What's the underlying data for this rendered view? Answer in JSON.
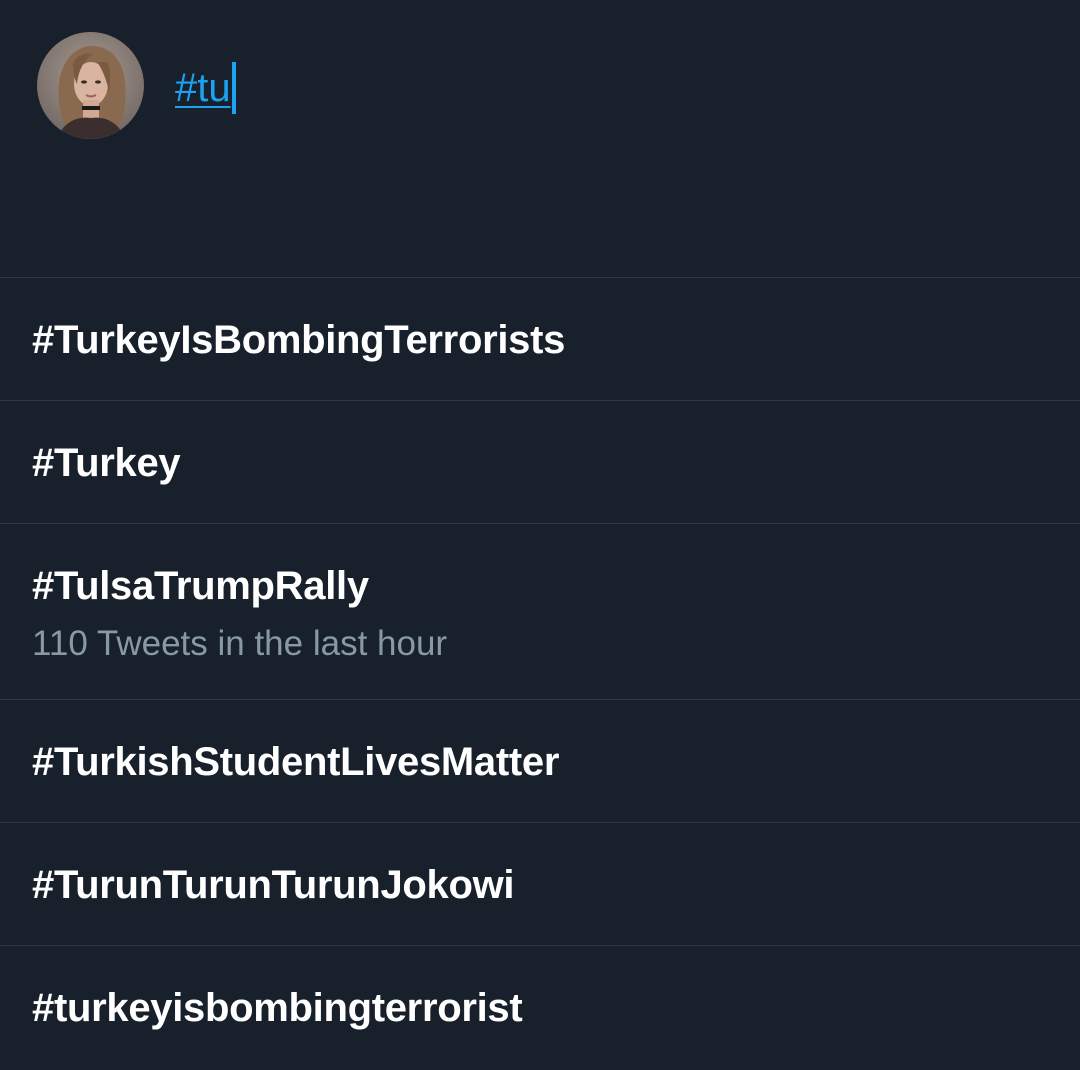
{
  "compose": {
    "query": "#tu",
    "avatar_icon": "user-avatar-photo"
  },
  "suggestions": [
    {
      "tag": "#TurkeyIsBombingTerrorists",
      "meta": ""
    },
    {
      "tag": "#Turkey",
      "meta": ""
    },
    {
      "tag": "#TulsaTrumpRally",
      "meta": "110 Tweets in the last hour"
    },
    {
      "tag": "#TurkishStudentLivesMatter",
      "meta": ""
    },
    {
      "tag": "#TurunTurunTurunJokowi",
      "meta": ""
    },
    {
      "tag": "#turkeyisbombingterrorist",
      "meta": ""
    }
  ],
  "colors": {
    "background": "#17202b",
    "accent": "#1da1f2",
    "divider": "#2c3846",
    "secondary_text": "#8899a6"
  }
}
